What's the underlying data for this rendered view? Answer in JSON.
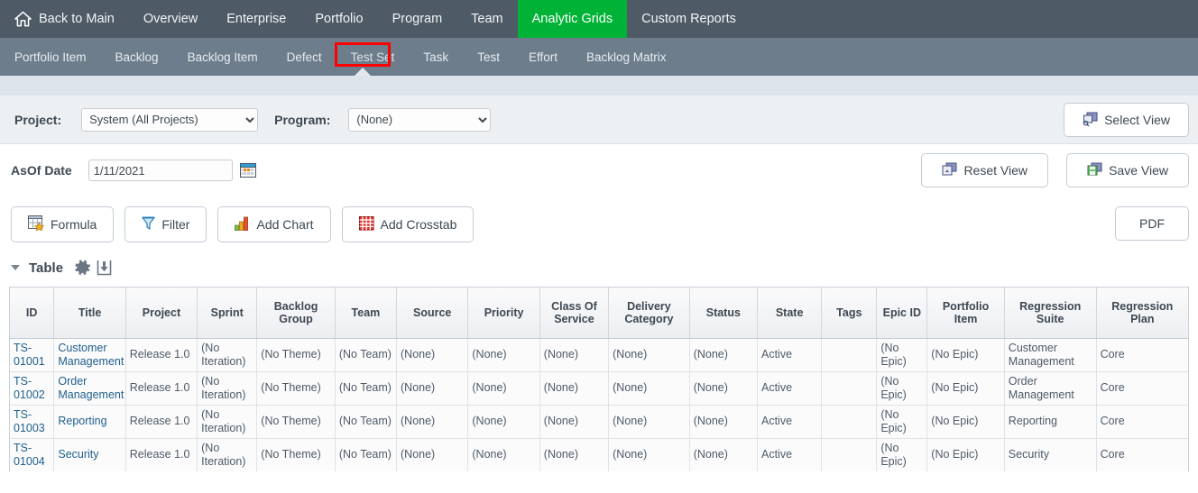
{
  "topnav": {
    "home_label": "Back to Main",
    "items": [
      {
        "label": "Overview",
        "active": false
      },
      {
        "label": "Enterprise",
        "active": false
      },
      {
        "label": "Portfolio",
        "active": false
      },
      {
        "label": "Program",
        "active": false
      },
      {
        "label": "Team",
        "active": false
      },
      {
        "label": "Analytic Grids",
        "active": true
      },
      {
        "label": "Custom Reports",
        "active": false
      }
    ],
    "active_color": "#00b336",
    "bg_color": "#4e5a66"
  },
  "subnav": {
    "bg_color": "#6d7d8c",
    "items": [
      {
        "label": "Portfolio Item"
      },
      {
        "label": "Backlog"
      },
      {
        "label": "Backlog Item"
      },
      {
        "label": "Defect"
      },
      {
        "label": "Test Set"
      },
      {
        "label": "Task"
      },
      {
        "label": "Test"
      },
      {
        "label": "Effort"
      },
      {
        "label": "Backlog Matrix"
      }
    ],
    "highlighted": "Test Set",
    "highlight_color": "#ff0000"
  },
  "filters": {
    "project_label": "Project:",
    "project_value": "System (All Projects)",
    "program_label": "Program:",
    "program_value": "(None)",
    "asof_label": "AsOf Date",
    "asof_value": "1/11/2021",
    "asof_placeholder": "mm/dd/yyyy",
    "select_view_label": "Select View",
    "reset_view_label": "Reset View",
    "save_view_label": "Save View"
  },
  "toolbar": {
    "formula_label": "Formula",
    "filter_label": "Filter",
    "add_chart_label": "Add Chart",
    "add_crosstab_label": "Add Crosstab",
    "pdf_label": "PDF"
  },
  "table_section": {
    "title": "Table"
  },
  "chart_data": {
    "type": "table",
    "title": "Table",
    "columns": [
      "ID",
      "Title",
      "Project",
      "Sprint",
      "Backlog Group",
      "Team",
      "Source",
      "Priority",
      "Class Of Service",
      "Delivery Category",
      "Status",
      "State",
      "Tags",
      "Epic ID",
      "Portfolio Item",
      "Regression Suite",
      "Regression Plan"
    ],
    "rows": [
      [
        "TS-01001",
        "Customer Management",
        "Release 1.0",
        "(No Iteration)",
        "(No Theme)",
        "(No Team)",
        "(None)",
        "(None)",
        "(None)",
        "(None)",
        "(None)",
        "Active",
        "",
        "(No Epic)",
        "(No Epic)",
        "Customer Management",
        "Core"
      ],
      [
        "TS-01002",
        "Order Management",
        "Release 1.0",
        "(No Iteration)",
        "(No Theme)",
        "(No Team)",
        "(None)",
        "(None)",
        "(None)",
        "(None)",
        "(None)",
        "Active",
        "",
        "(No Epic)",
        "(No Epic)",
        "Order Management",
        "Core"
      ],
      [
        "TS-01003",
        "Reporting",
        "Release 1.0",
        "(No Iteration)",
        "(No Theme)",
        "(No Team)",
        "(None)",
        "(None)",
        "(None)",
        "(None)",
        "(None)",
        "Active",
        "",
        "(No Epic)",
        "(No Epic)",
        "Reporting",
        "Core"
      ],
      [
        "TS-01004",
        "Security",
        "Release 1.0",
        "(No Iteration)",
        "(No Theme)",
        "(No Team)",
        "(None)",
        "(None)",
        "(None)",
        "(None)",
        "(None)",
        "Active",
        "",
        "(No Epic)",
        "(No Epic)",
        "Security",
        "Core"
      ]
    ]
  }
}
